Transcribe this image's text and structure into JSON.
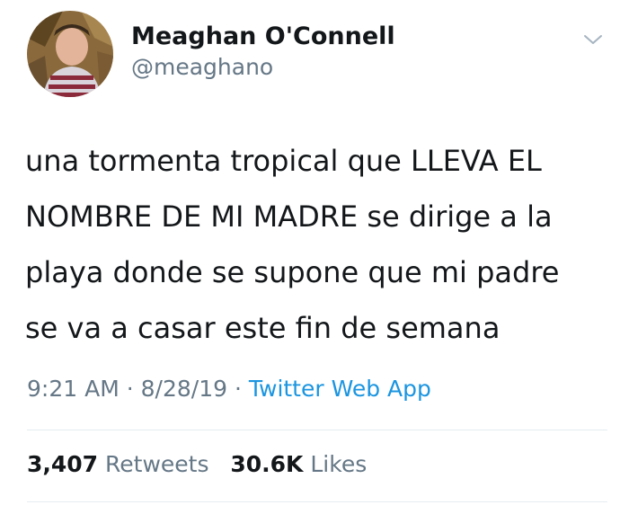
{
  "user": {
    "display_name": "Meaghan O'Connell",
    "handle": "@meaghano"
  },
  "tweet": {
    "lines": [
      "una tormenta tropical que LLEVA EL",
      "NOMBRE DE MI MADRE se dirige a la",
      "playa donde se supone que mi padre",
      "se va a casar este fin de semana"
    ]
  },
  "meta": {
    "time": "9:21 AM",
    "separator": "·",
    "date": "8/28/19",
    "source": "Twitter Web App"
  },
  "stats": {
    "retweets_count": "3,407",
    "retweets_label": "Retweets",
    "likes_count": "30.6K",
    "likes_label": "Likes"
  },
  "icons": {
    "caret": "chevron-down-icon"
  },
  "colors": {
    "text": "#14171a",
    "secondary": "#657786",
    "link": "#1b95e0",
    "divider": "#e6ecf0"
  }
}
